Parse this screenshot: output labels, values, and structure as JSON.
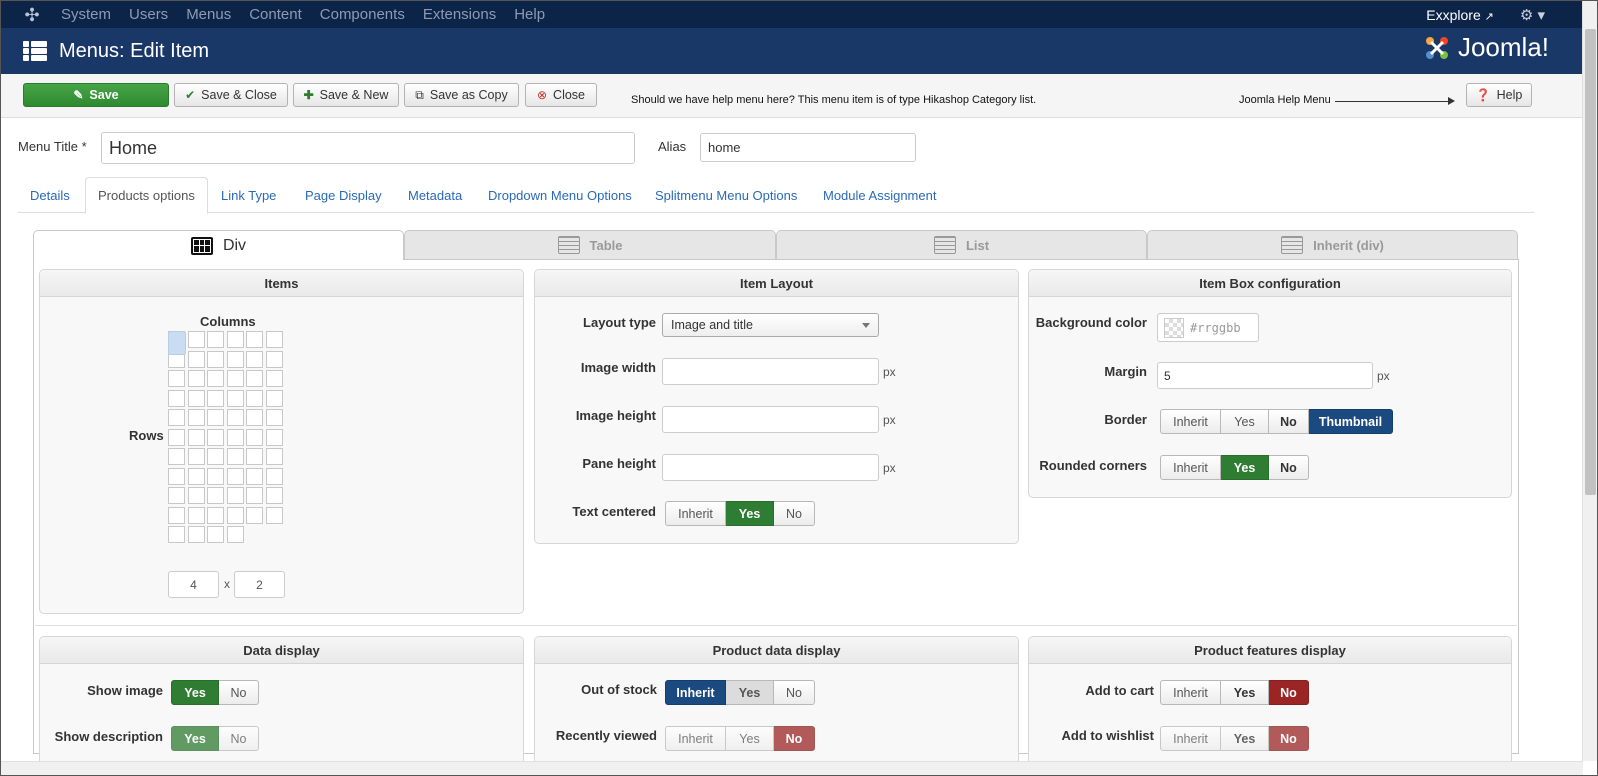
{
  "topnav": {
    "items": [
      "System",
      "Users",
      "Menus",
      "Content",
      "Components",
      "Extensions",
      "Help"
    ],
    "site_link": "Exxplore",
    "site_link_icon": "external-link-icon",
    "settings_icon": "gear-icon"
  },
  "header": {
    "title": "Menus: Edit Item",
    "brand": "Joomla!"
  },
  "toolbar": {
    "save": "Save",
    "save_close": "Save & Close",
    "save_new": "Save & New",
    "save_copy": "Save as Copy",
    "close": "Close",
    "help": "Help",
    "note": "Should we have help menu here? This menu item is of type Hikashop Category list.",
    "help_note": "Joomla Help Menu"
  },
  "form": {
    "menu_title_label": "Menu Title *",
    "menu_title_value": "Home",
    "alias_label": "Alias",
    "alias_value": "home"
  },
  "tabs": [
    "Details",
    "Products options",
    "Link Type",
    "Page Display",
    "Metadata",
    "Dropdown Menu Options",
    "Splitmenu Menu Options",
    "Module Assignment"
  ],
  "active_tab": "Products options",
  "layout_tabs": [
    "Div",
    "Table",
    "List",
    "Inherit (div)"
  ],
  "active_layout": "Div",
  "items_panel": {
    "title": "Items",
    "columns_label": "Columns",
    "rows_label": "Rows",
    "columns": "4",
    "x": "x",
    "rows": "2"
  },
  "item_layout": {
    "title": "Item Layout",
    "layout_type_label": "Layout type",
    "layout_type_value": "Image and title",
    "image_width_label": "Image width",
    "image_height_label": "Image height",
    "pane_height_label": "Pane height",
    "unit": "px",
    "text_centered_label": "Text centered",
    "text_centered_options": [
      "Inherit",
      "Yes",
      "No"
    ],
    "text_centered_value": "Yes"
  },
  "item_box": {
    "title": "Item Box configuration",
    "bg_label": "Background color",
    "bg_placeholder": "#rrggbb",
    "margin_label": "Margin",
    "margin_value": "5",
    "unit": "px",
    "border_label": "Border",
    "border_options": [
      "Inherit",
      "Yes",
      "No",
      "Thumbnail"
    ],
    "border_value": "Thumbnail",
    "rounded_label": "Rounded corners",
    "rounded_options": [
      "Inherit",
      "Yes",
      "No"
    ],
    "rounded_value": "Yes"
  },
  "data_display": {
    "title": "Data display",
    "show_image_label": "Show image",
    "show_description_label": "Show description",
    "options": [
      "Yes",
      "No"
    ]
  },
  "product_data_display": {
    "title": "Product data display",
    "out_of_stock_label": "Out of stock",
    "recently_viewed_label": "Recently viewed",
    "options": [
      "Inherit",
      "Yes",
      "No"
    ]
  },
  "product_features": {
    "title": "Product features display",
    "add_to_cart_label": "Add to cart",
    "add_to_wishlist_label": "Add to wishlist",
    "options": [
      "Inherit",
      "Yes",
      "No"
    ]
  },
  "colors": {
    "topnav": "#0d2449",
    "header": "#1a3867",
    "green": "#2f7d32",
    "blue": "#1b4a80",
    "red": "#9b2424",
    "link": "#2a69b8"
  }
}
